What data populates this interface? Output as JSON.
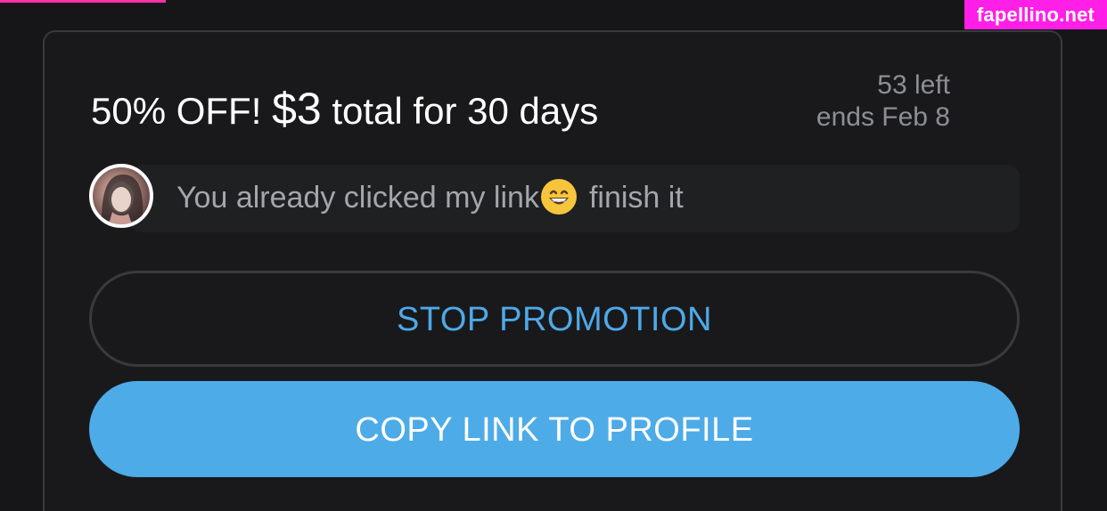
{
  "watermark": "fapellino.net",
  "promo": {
    "title_prefix": "50% OFF!",
    "price": "$3",
    "title_suffix": "total for 30 days",
    "left_count": "53 left",
    "ends": "ends Feb 8"
  },
  "message": {
    "text_before_emoji": "You already clicked my link",
    "emoji_icon": "grinning-face-emoji",
    "text_after_emoji": "finish it"
  },
  "buttons": {
    "stop_label": "STOP PROMOTION",
    "copy_label": "COPY LINK TO PROFILE"
  },
  "colors": {
    "accent": "#4dabe8",
    "watermark": "#ff1fe6"
  }
}
